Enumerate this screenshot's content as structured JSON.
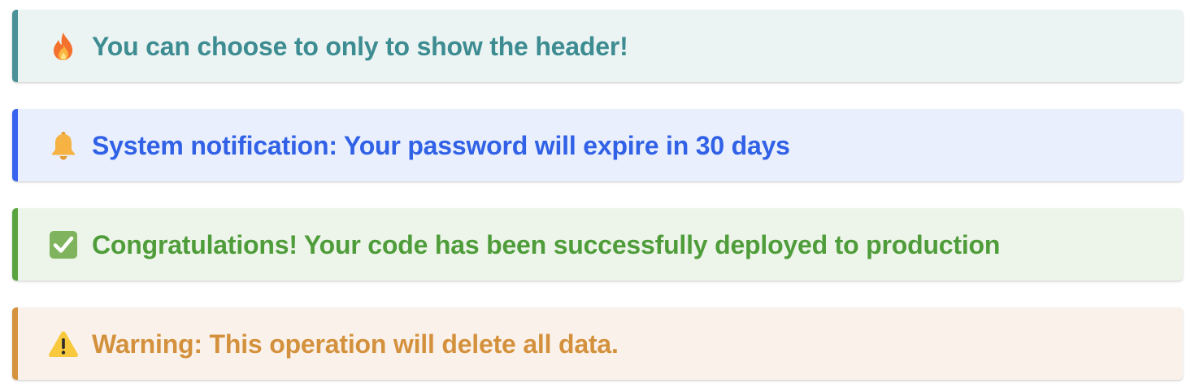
{
  "alerts": [
    {
      "type": "tip",
      "icon": "fire-icon",
      "text": "You can choose to only to show the header!",
      "colors": {
        "accent": "#4a9198",
        "background": "#ebf4f3",
        "text": "#3d8c91"
      }
    },
    {
      "type": "info",
      "icon": "bell-icon",
      "text": "System notification: Your password will expire in 30 days",
      "colors": {
        "accent": "#3863f0",
        "background": "#e9effd",
        "text": "#3061e6"
      }
    },
    {
      "type": "success",
      "icon": "check-box-icon",
      "text": "Congratulations! Your code has been successfully deployed to production",
      "colors": {
        "accent": "#59a43f",
        "background": "#edf5ea",
        "text": "#4f9c3a"
      }
    },
    {
      "type": "warning",
      "icon": "warning-triangle-icon",
      "text": "Warning: This operation will delete all data.",
      "colors": {
        "accent": "#d5933e",
        "background": "#faf2ea",
        "text": "#d4913d"
      }
    }
  ]
}
